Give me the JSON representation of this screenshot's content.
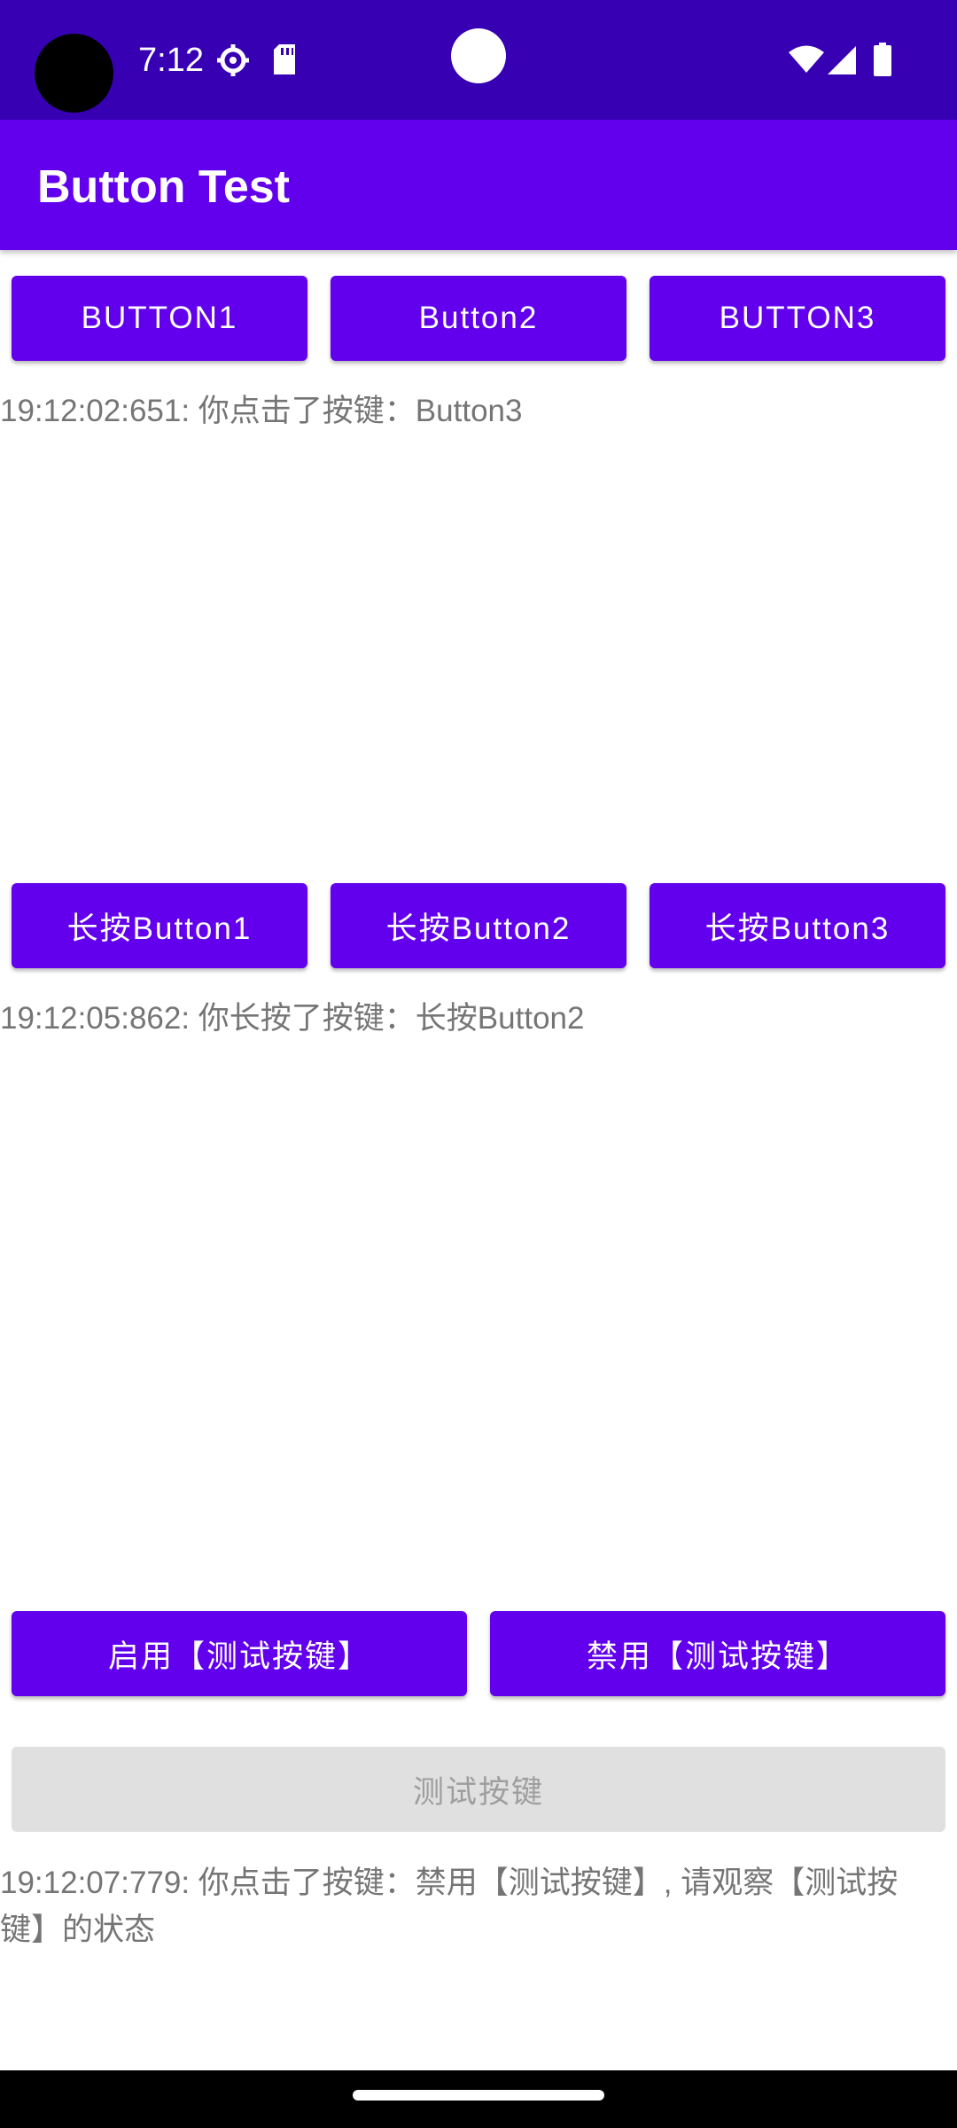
{
  "status_bar": {
    "time": "7:12",
    "icons": [
      "settings-icon",
      "sd-card-icon",
      "wifi-icon",
      "signal-icon",
      "battery-icon"
    ]
  },
  "app_bar": {
    "title": "Button Test"
  },
  "row1": {
    "buttons": [
      "BUTTON1",
      "Button2",
      "BUTTON3"
    ],
    "log": "19:12:02:651: 你点击了按键：Button3"
  },
  "row2": {
    "buttons": [
      "长按Button1",
      "长按Button2",
      "长按Button3"
    ],
    "log": "19:12:05:862: 你长按了按键：长按Button2"
  },
  "row3": {
    "enable_label": "启用【测试按键】",
    "disable_label": "禁用【测试按键】",
    "test_label": "测试按键",
    "log_line1": "19:12:07:779: 你点击了按键：禁用【测试按键】, 请观察【测试按",
    "log_line2": "键】的状态"
  },
  "colors": {
    "status_bar": "#3700B3",
    "app_bar": "#6200EE",
    "button": "#6200EE",
    "disabled_button": "#E0E0E0",
    "log_text": "#757575"
  }
}
